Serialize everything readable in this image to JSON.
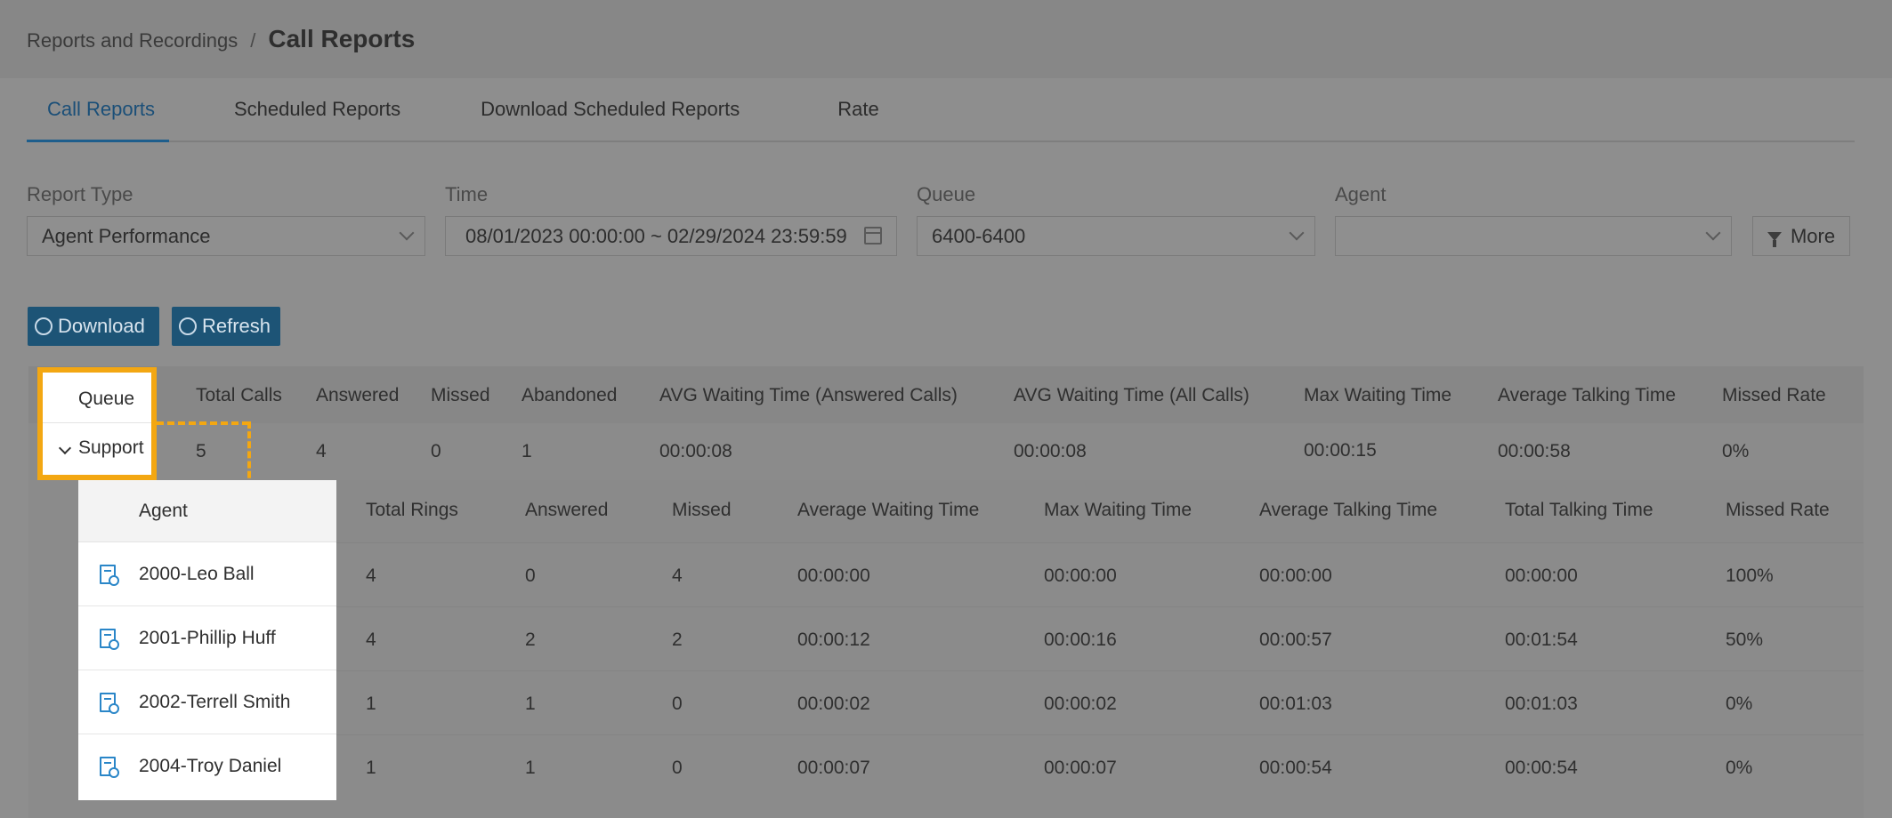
{
  "breadcrumb": {
    "parent": "Reports and Recordings",
    "separator": "/",
    "current": "Call Reports"
  },
  "tabs": [
    {
      "label": "Call Reports",
      "active": true
    },
    {
      "label": "Scheduled Reports",
      "active": false
    },
    {
      "label": "Download Scheduled Reports",
      "active": false
    },
    {
      "label": "Rate",
      "active": false
    }
  ],
  "filters": {
    "report_type": {
      "label": "Report Type",
      "value": "Agent Performance"
    },
    "time": {
      "label": "Time",
      "value": "08/01/2023 00:00:00 ~ 02/29/2024 23:59:59"
    },
    "queue": {
      "label": "Queue",
      "value": "6400-6400"
    },
    "agent": {
      "label": "Agent",
      "value": ""
    },
    "more_label": "More"
  },
  "actions": {
    "download_label": "Download",
    "refresh_label": "Refresh"
  },
  "queue_table": {
    "headers": [
      "Queue",
      "Total Calls",
      "Answered",
      "Missed",
      "Abandoned",
      "AVG Waiting Time (Answered Calls)",
      "AVG Waiting Time (All Calls)",
      "Max Waiting Time",
      "Average Talking Time",
      "Missed Rate"
    ],
    "row": [
      "Support",
      "5",
      "4",
      "0",
      "1",
      "00:00:08",
      "00:00:08",
      "00:00:15",
      "00:00:58",
      "0%"
    ]
  },
  "agent_table": {
    "headers": [
      "Agent",
      "Total Rings",
      "Answered",
      "Missed",
      "Average Waiting Time",
      "Max Waiting Time",
      "Average Talking Time",
      "Total Talking Time",
      "Missed Rate"
    ],
    "rows": [
      [
        "2000-Leo Ball",
        "4",
        "0",
        "4",
        "00:00:00",
        "00:00:00",
        "00:00:00",
        "00:00:00",
        "100%"
      ],
      [
        "2001-Phillip Huff",
        "4",
        "2",
        "2",
        "00:00:12",
        "00:00:16",
        "00:00:57",
        "00:01:54",
        "50%"
      ],
      [
        "2002-Terrell Smith",
        "1",
        "1",
        "0",
        "00:00:02",
        "00:00:02",
        "00:01:03",
        "00:01:03",
        "0%"
      ],
      [
        "2004-Troy Daniel",
        "1",
        "1",
        "0",
        "00:00:07",
        "00:00:07",
        "00:00:54",
        "00:00:54",
        "0%"
      ]
    ]
  },
  "colors": {
    "highlight": "#f3a712",
    "accent": "#1e5e8c",
    "icon_blue": "#2a86c8",
    "overlay": "#8c8c8c"
  }
}
